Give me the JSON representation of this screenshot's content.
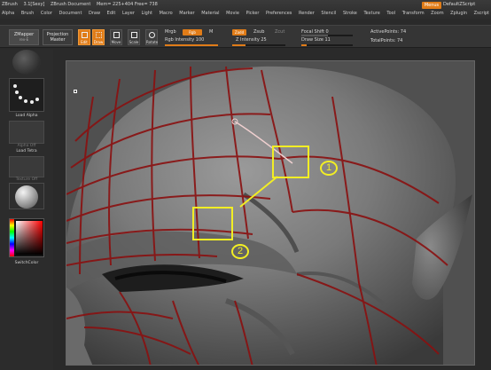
{
  "menubar": {
    "title_items": [
      "ZBrush",
      "3.1[Sexy]",
      "ZBrush Document",
      "Mem= 225+404 Free= 738"
    ],
    "menu_items": [
      "Alpha",
      "Brush",
      "Color",
      "Document",
      "Draw",
      "Edit",
      "Layer",
      "Light",
      "Macro",
      "Marker",
      "Material",
      "Movie",
      "Picker",
      "Preferences",
      "Render",
      "Stencil",
      "Stroke",
      "Texture",
      "Tool",
      "Transform",
      "Zoom",
      "Zplugin",
      "Zscript"
    ],
    "menus_button": "Menus",
    "default_script": "DefaultZScript"
  },
  "toolbar": {
    "zmapper": "ZMapper",
    "zmapper_sub": "rev-E",
    "projection": "Projection",
    "projection_sub": "Master",
    "buttons": [
      "Edit",
      "Draw",
      "Move",
      "Scale",
      "Rotate"
    ],
    "mrgb": "Mrgb",
    "rgb": "Rgb",
    "m": "M",
    "rgb_intensity": "Rgb Intensity 100",
    "zadd": "Zadd",
    "zsub": "Zsub",
    "zcut": "Zcut",
    "z_intensity": "Z Intensity 25",
    "focal_shift": "Focal Shift 0",
    "draw_size": "Draw Size 11",
    "active_points": "ActivePoints: 74",
    "total_points": "TotalPoints: 74"
  },
  "leftshelf": {
    "load_alpha": "Load Alpha",
    "alpha_off": "Alpha Off",
    "load_tetra": "Load Tetra",
    "texture_off": "Texture Off",
    "switch_color": "SwitchColor"
  },
  "callouts": {
    "one": "1",
    "two": "2"
  },
  "colors": {
    "accent": "#e07c18",
    "callout": "#f2ee24",
    "wire": "#8a1010"
  }
}
